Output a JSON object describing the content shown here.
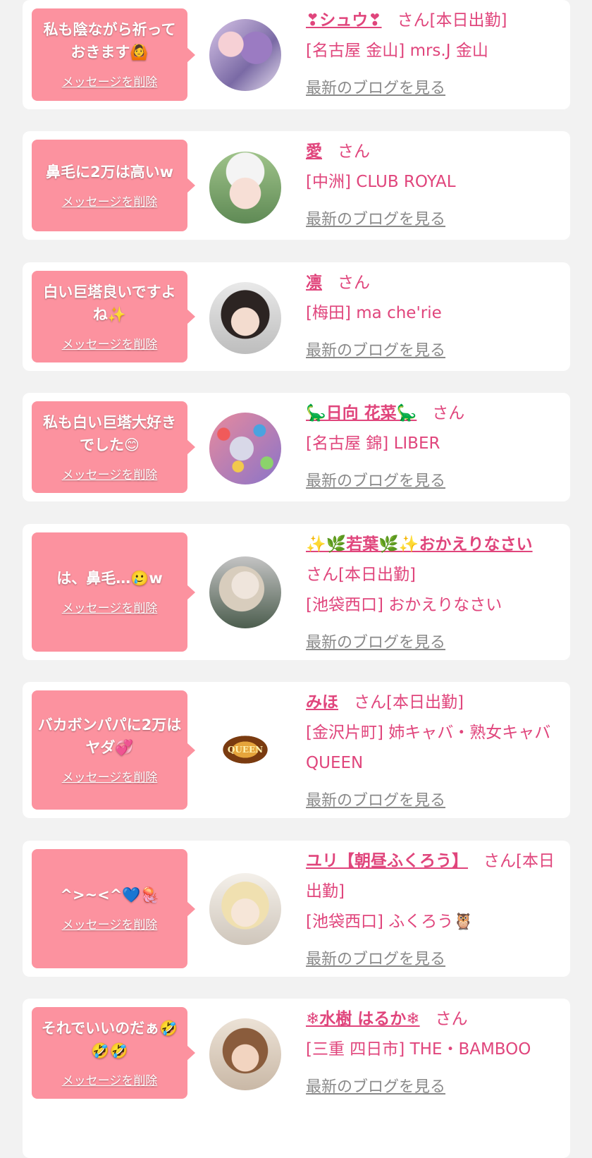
{
  "delete_label": "メッセージを削除",
  "blog_label": "最新のブログを見る",
  "items": [
    {
      "message": "私も陰ながら祈っておきます🙆",
      "name": "❣シュウ❣",
      "suffix": "さん[本日出勤]",
      "shop": "[名古屋 金山] mrs.J 金山",
      "avatar": "avatar-photo-1"
    },
    {
      "message": "鼻毛に2万は高いw",
      "name": "愛",
      "suffix": "さん",
      "shop": "[中洲] CLUB ROYAL",
      "avatar": "avatar-photo-2"
    },
    {
      "message": "白い巨塔良いですよね✨",
      "name": "凛",
      "suffix": "さん",
      "shop": "[梅田] ma che'rie",
      "avatar": "avatar-photo-3"
    },
    {
      "message": "私も白い巨塔大好きでした😊",
      "name": "🦕日向 花菜🦕",
      "suffix": "さん",
      "shop": "[名古屋 錦] LIBER",
      "avatar": "avatar-photo-4"
    },
    {
      "message": "は、鼻毛…🥲w",
      "name": "✨🌿若葉🌿✨おかえりなさい",
      "suffix": "さん[本日出勤]",
      "shop": "[池袋西口] おかえりなさい",
      "avatar": "avatar-photo-5"
    },
    {
      "message": "バカボンパパに2万はヤダ💞",
      "name": "みほ",
      "suffix": "さん[本日出勤]",
      "shop": "[金沢片町] 姉キャバ・熟女キャバ QUEEN",
      "avatar": "avatar-queen-logo"
    },
    {
      "message": "^>~<^💙🪼",
      "name": "ユリ【朝昼ふくろう】",
      "suffix": "さん[本日出勤]",
      "shop": "[池袋西口] ふくろう🦉",
      "avatar": "avatar-photo-7"
    },
    {
      "message": "それでいいのだぁ🤣🤣🤣",
      "name": "❄水樹 はるか❄",
      "suffix": "さん",
      "shop": "[三重 四日市] THE・BAMBOO",
      "avatar": "avatar-photo-8"
    }
  ],
  "colors": {
    "bubble": "#fc929f",
    "name": "#e0457c",
    "blog_link": "#8a8a8a",
    "page_bg": "#f2f2f2"
  }
}
